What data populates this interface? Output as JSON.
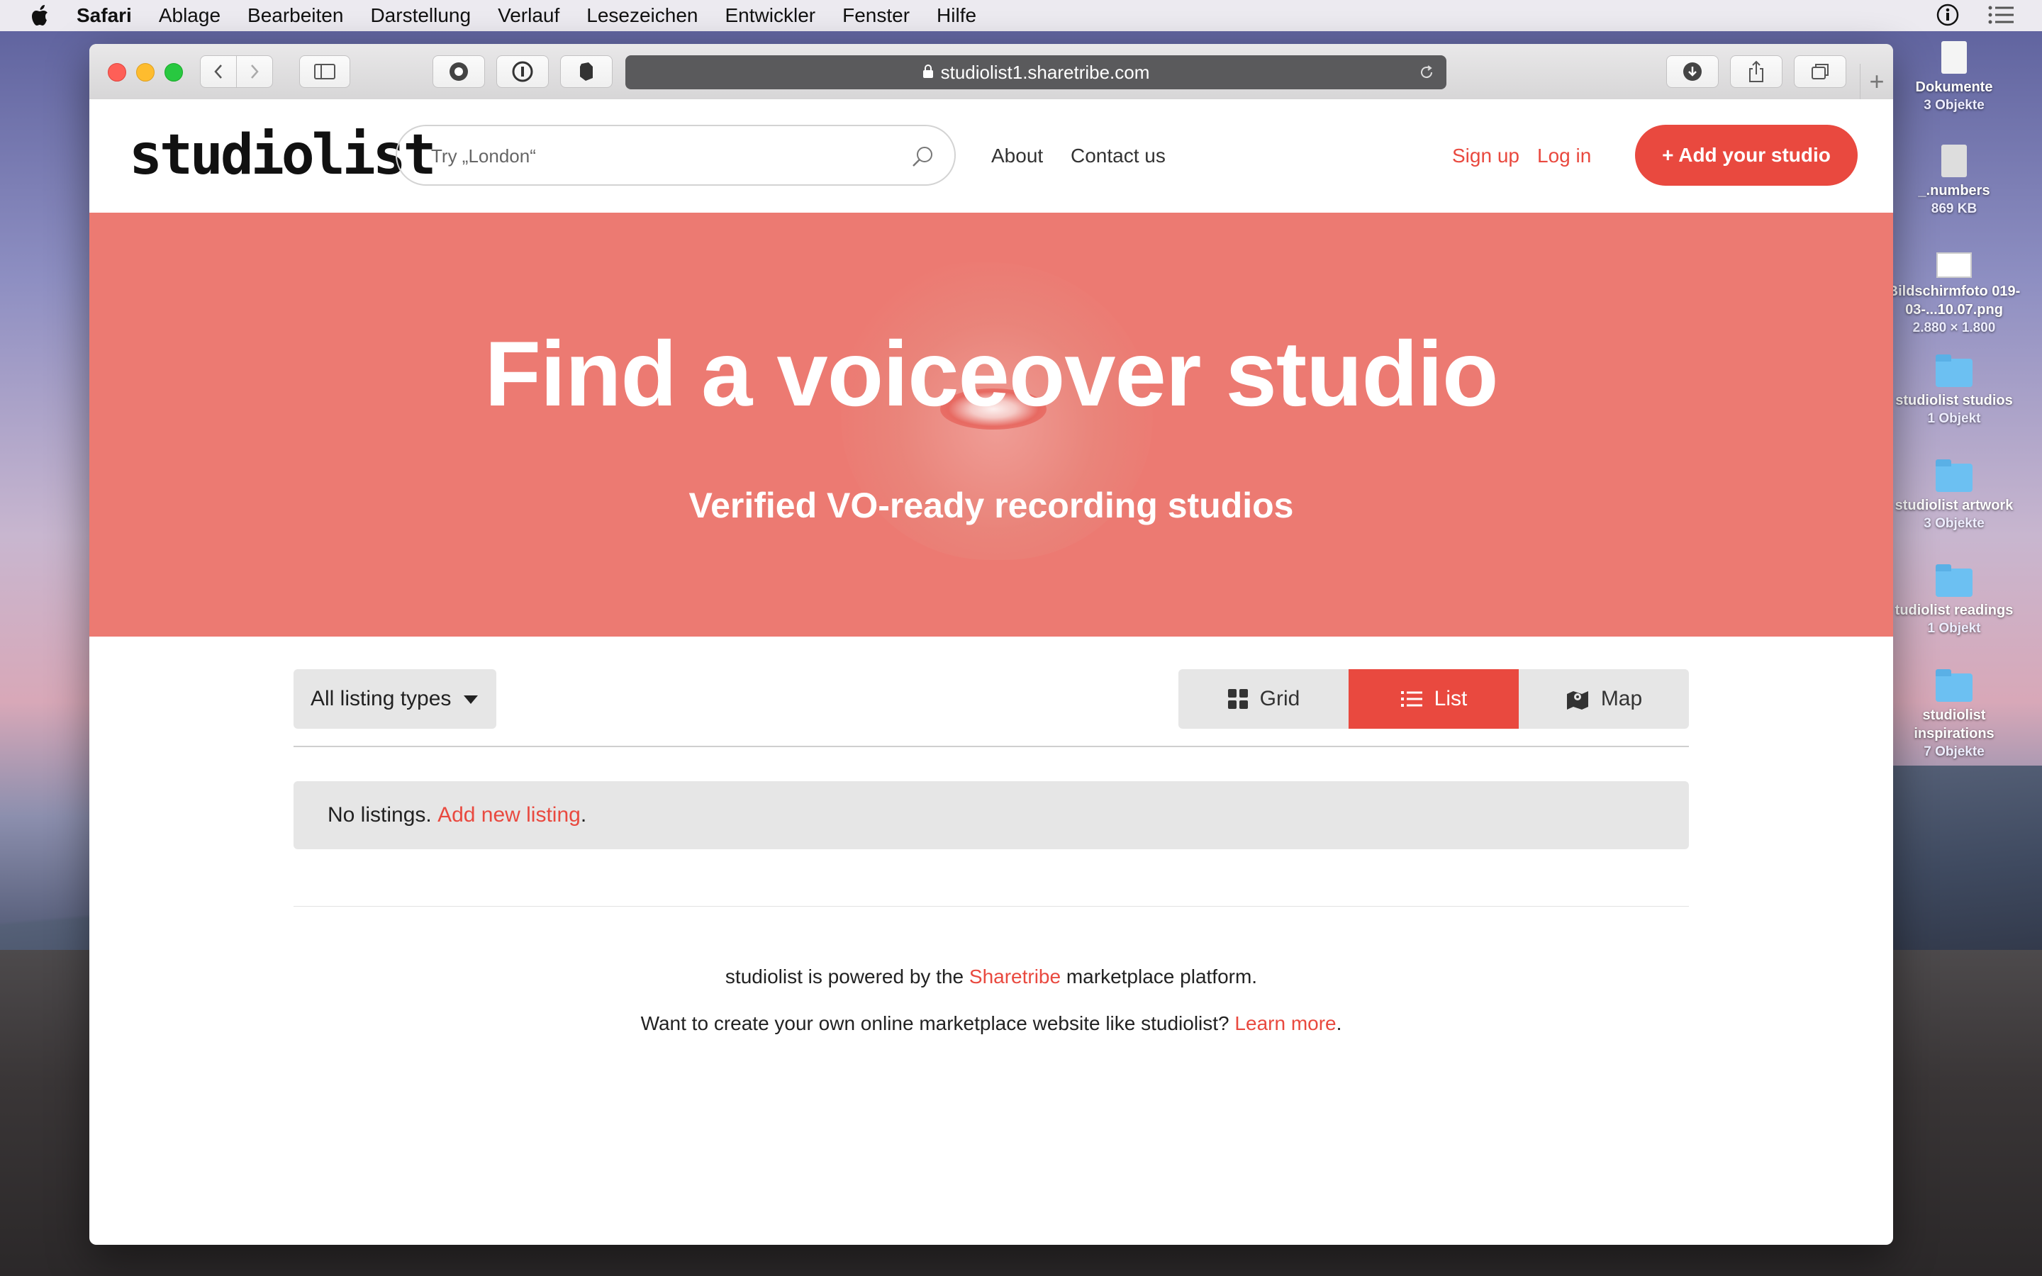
{
  "menubar": {
    "app": "Safari",
    "items": [
      "Ablage",
      "Bearbeiten",
      "Darstellung",
      "Verlauf",
      "Lesezeichen",
      "Entwickler",
      "Fenster",
      "Hilfe"
    ]
  },
  "browser": {
    "url": "studiolist1.sharetribe.com"
  },
  "site": {
    "logo": "studiolist",
    "search_placeholder": "Try „London“",
    "nav": {
      "about": "About",
      "contact": "Contact us"
    },
    "auth": {
      "signup": "Sign up",
      "login": "Log in"
    },
    "add_button": "+ Add your studio"
  },
  "hero": {
    "title": "Find a voiceover studio",
    "subtitle": "Verified VO-ready recording studios"
  },
  "filters": {
    "listing_type": "All listing types"
  },
  "view_toggle": {
    "grid": "Grid",
    "list": "List",
    "map": "Map",
    "active": "list"
  },
  "listings": {
    "empty_text": "No listings.",
    "add_link": "Add new listing",
    "period": "."
  },
  "footer": {
    "powered_prefix": "studiolist is powered by the",
    "powered_link": "Sharetribe",
    "powered_suffix": "marketplace platform.",
    "want_prefix": "Want to create your own online marketplace website like studiolist?",
    "learn_link": "Learn more",
    "period": "."
  },
  "desktop": {
    "icons": [
      {
        "name": "Dokumente",
        "sub": "3 Objekte",
        "kind": "doc"
      },
      {
        "name": "_.numbers",
        "sub": "869 KB",
        "kind": "doc"
      },
      {
        "name": "Bildschirmfoto 019-03-...10.07.png",
        "sub": "2.880 × 1.800",
        "kind": "image"
      },
      {
        "name": "studiolist studios",
        "sub": "1 Objekt",
        "kind": "folder"
      },
      {
        "name": "studiolist artwork",
        "sub": "3 Objekte",
        "kind": "folder"
      },
      {
        "name": "tudiolist readings",
        "sub": "1 Objekt",
        "kind": "folder"
      },
      {
        "name": "studiolist inspirations",
        "sub": "7 Objekte",
        "kind": "folder"
      }
    ]
  },
  "colors": {
    "accent": "#e9493f",
    "hero_bg": "#ec7a72",
    "panel_bg": "#e6e6e6"
  }
}
